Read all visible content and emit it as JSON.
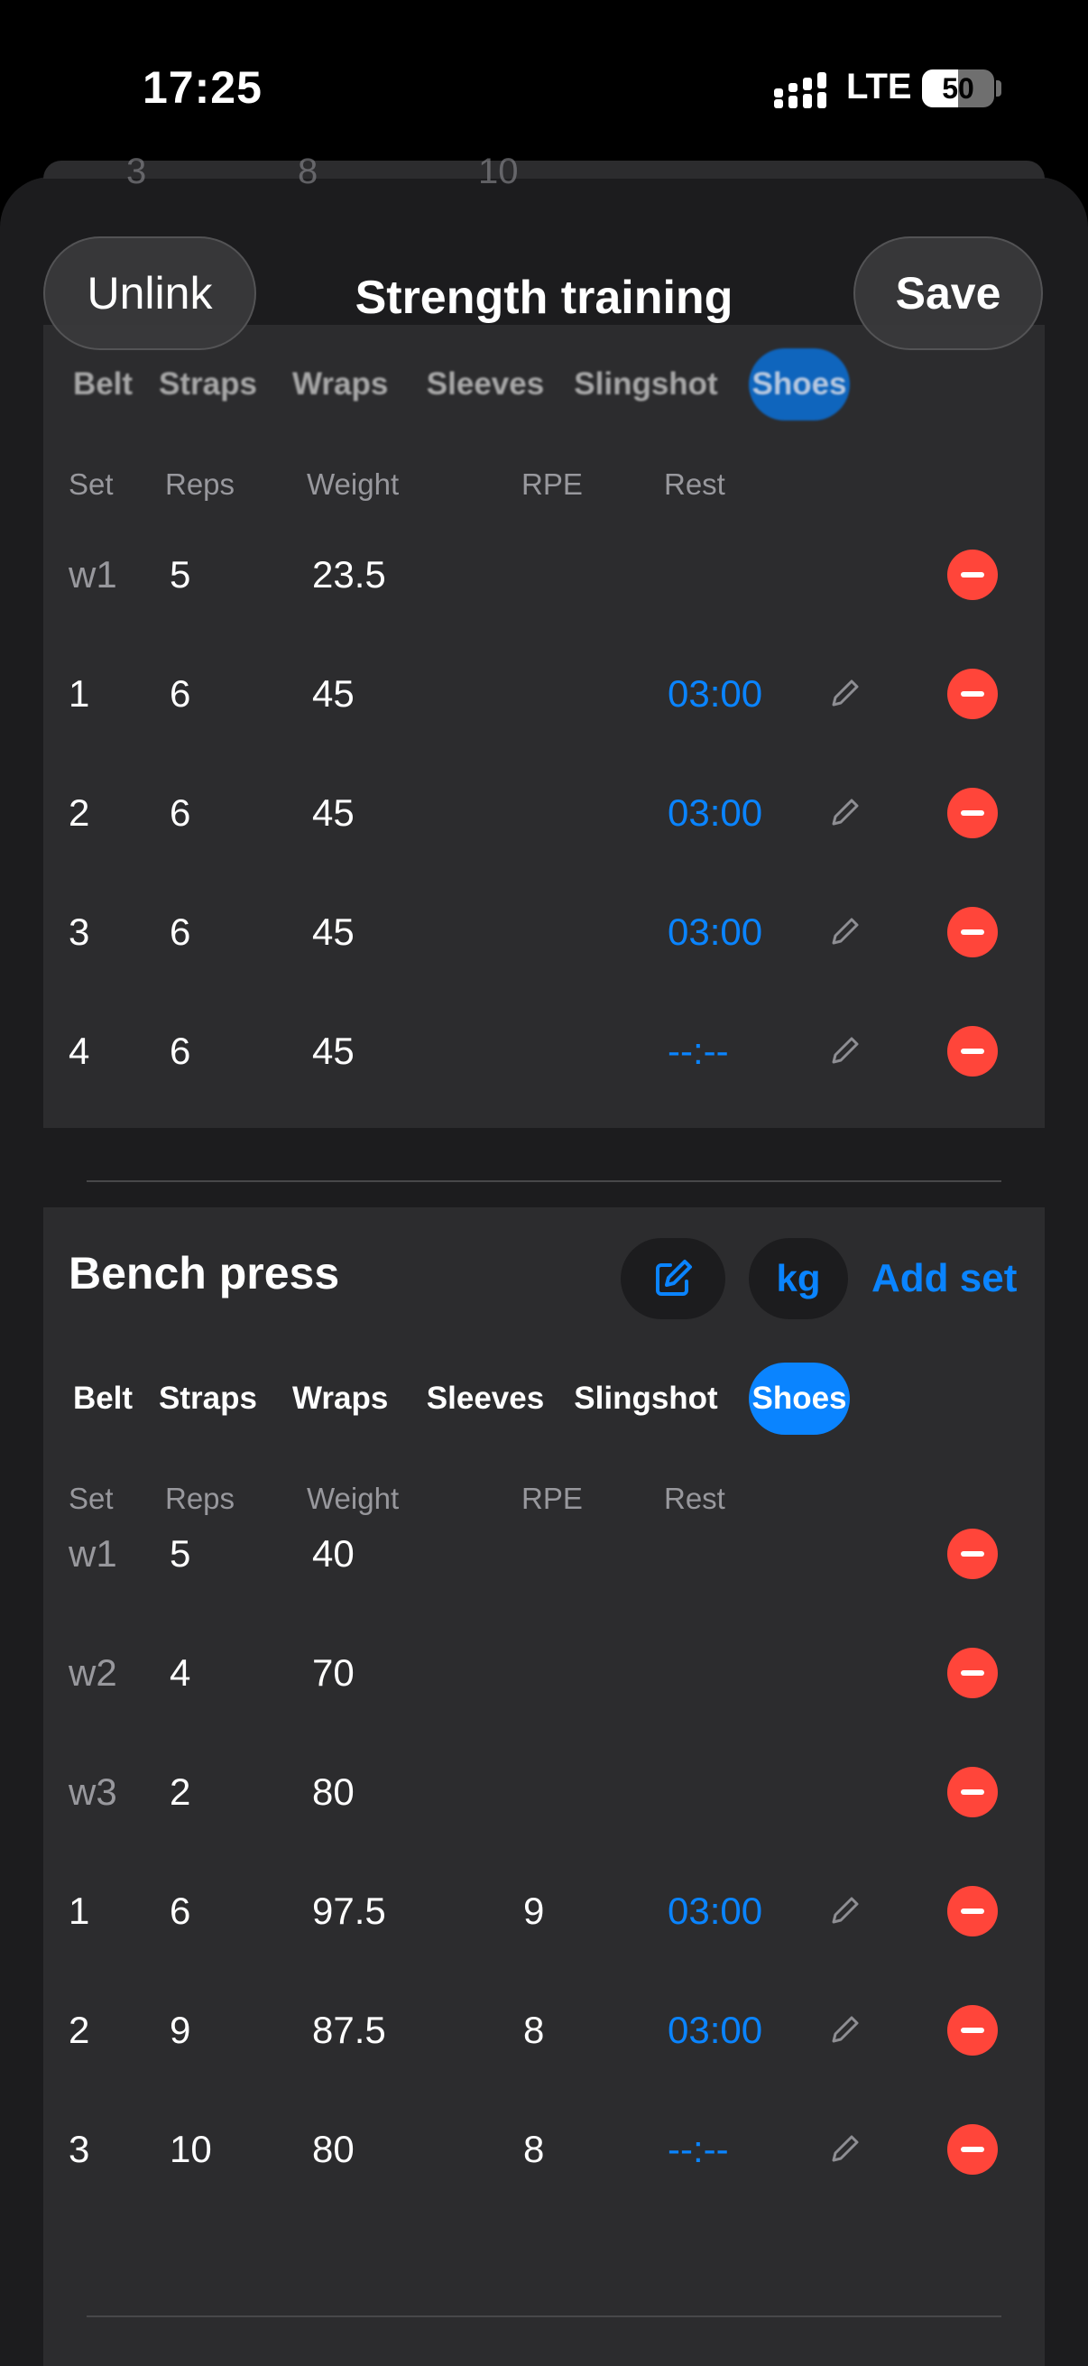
{
  "status_bar": {
    "time": "17:25",
    "network": "LTE",
    "battery": "50",
    "battery_level": 0.5
  },
  "header": {
    "title": "Strength training",
    "unlink_label": "Unlink",
    "save_label": "Save"
  },
  "colors": {
    "accent": "#0a84ff",
    "destructive": "#ff453a",
    "card": "#2c2c2e",
    "sheet": "#1c1c1e"
  },
  "columns": {
    "set": "Set",
    "reps": "Reps",
    "weight": "Weight",
    "rpe": "RPE",
    "rest": "Rest"
  },
  "equipment": [
    "Belt",
    "Straps",
    "Wraps",
    "Sleeves",
    "Slingshot",
    "Shoes"
  ],
  "peek_row": [
    "3",
    "8",
    "10"
  ],
  "exercise1": {
    "active_equipment": "Shoes",
    "sets": [
      {
        "set": "w1",
        "reps": "5",
        "weight": "23.5",
        "rpe": "",
        "rest": ""
      },
      {
        "set": "1",
        "reps": "6",
        "weight": "45",
        "rpe": "",
        "rest": "03:00"
      },
      {
        "set": "2",
        "reps": "6",
        "weight": "45",
        "rpe": "",
        "rest": "03:00"
      },
      {
        "set": "3",
        "reps": "6",
        "weight": "45",
        "rpe": "",
        "rest": "03:00"
      },
      {
        "set": "4",
        "reps": "6",
        "weight": "45",
        "rpe": "",
        "rest": "--:--"
      }
    ]
  },
  "exercise2": {
    "name": "Bench press",
    "unit_label": "kg",
    "add_set_label": "Add set",
    "edit_icon": "edit-icon",
    "active_equipment": "Shoes",
    "sets": [
      {
        "set": "w1",
        "reps": "5",
        "weight": "40",
        "rpe": "",
        "rest": ""
      },
      {
        "set": "w2",
        "reps": "4",
        "weight": "70",
        "rpe": "",
        "rest": ""
      },
      {
        "set": "w3",
        "reps": "2",
        "weight": "80",
        "rpe": "",
        "rest": ""
      },
      {
        "set": "1",
        "reps": "6",
        "weight": "97.5",
        "rpe": "9",
        "rest": "03:00"
      },
      {
        "set": "2",
        "reps": "9",
        "weight": "87.5",
        "rpe": "8",
        "rest": "03:00"
      },
      {
        "set": "3",
        "reps": "10",
        "weight": "80",
        "rpe": "8",
        "rest": "--:--"
      }
    ]
  }
}
